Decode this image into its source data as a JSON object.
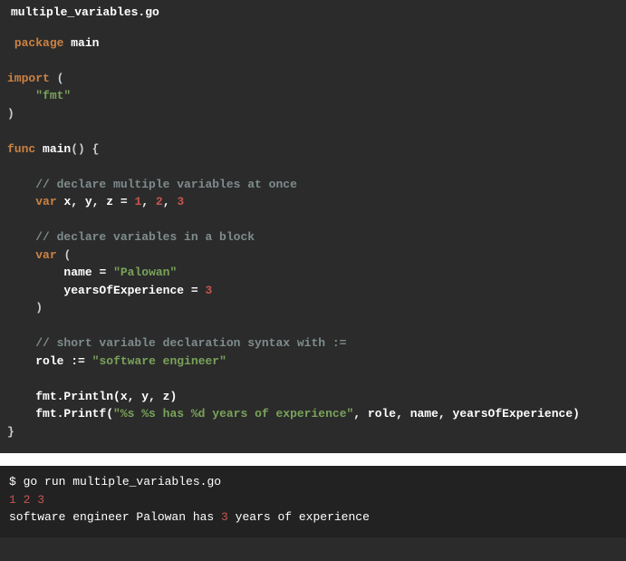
{
  "filename": "multiple_variables.go",
  "code": {
    "package_kw": "package",
    "package_name": "main",
    "import_kw": "import",
    "import_open": "(",
    "import_pkg": "\"fmt\"",
    "import_close": ")",
    "func_kw": "func",
    "func_name": "main",
    "func_sig": "()",
    "brace_open": "{",
    "brace_close": "}",
    "comment1": "// declare multiple variables at once",
    "var1_kw": "var",
    "var1_names": "x, y, z",
    "var1_eq": "=",
    "var1_n1": "1",
    "var1_c1": ",",
    "var1_n2": "2",
    "var1_c2": ",",
    "var1_n3": "3",
    "comment2": "// declare variables in a block",
    "var2_kw": "var",
    "var2_open": "(",
    "var2_name1": "name",
    "var2_eq1": "=",
    "var2_val1": "\"Palowan\"",
    "var2_name2": "yearsOfExperience",
    "var2_eq2": "=",
    "var2_val2": "3",
    "var2_close": ")",
    "comment3": "// short variable declaration syntax with :=",
    "role_name": "role",
    "role_op": ":=",
    "role_val": "\"software engineer\"",
    "println_call": "fmt.Println",
    "println_args": "(x, y, z)",
    "printf_call": "fmt.Printf",
    "printf_open": "(",
    "printf_fmt": "\"%s %s has %d years of experience\"",
    "printf_rest": ", role, name, yearsOfExperience)"
  },
  "terminal": {
    "cmd_prompt": "$ ",
    "cmd": "go run multiple_variables.go",
    "out1_a": "1",
    "out1_s1": " ",
    "out1_b": "2",
    "out1_s2": " ",
    "out1_c": "3",
    "out2_a": "software engineer Palowan has ",
    "out2_b": "3",
    "out2_c": " years of experience"
  }
}
